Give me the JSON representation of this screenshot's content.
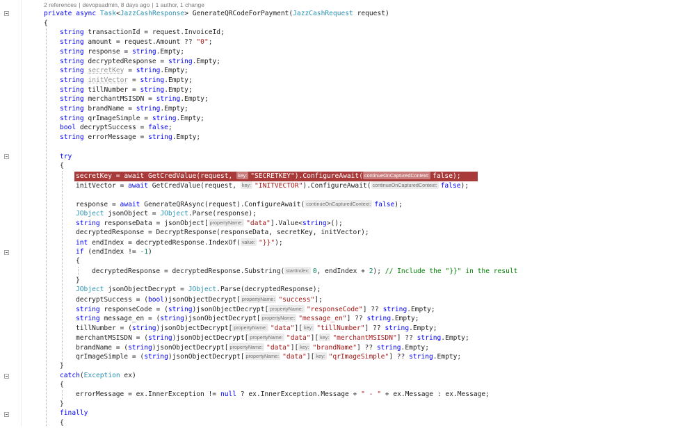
{
  "codelens": {
    "references": "2 references",
    "author_time": "devopsadmin, 8 days ago",
    "changes": "1 author, 1 change"
  },
  "colors": {
    "keyword": "#0000ff",
    "type": "#2b91af",
    "string": "#a31515",
    "number": "#098658",
    "comment": "#008000",
    "breakpoint_bg": "#a83a3a"
  },
  "code": [
    {
      "indent": 0,
      "tokens": [
        [
          "kw",
          "private"
        ],
        [
          "p",
          " "
        ],
        [
          "kw",
          "async"
        ],
        [
          "p",
          " "
        ],
        [
          "ty",
          "Task"
        ],
        [
          "p",
          "<"
        ],
        [
          "ty",
          "JazzCashResponse"
        ],
        [
          "p",
          "> GenerateQRCodeForPayment("
        ],
        [
          "ty",
          "JazzCashRequest"
        ],
        [
          "p",
          " request)"
        ]
      ]
    },
    {
      "indent": 0,
      "tokens": [
        [
          "p",
          "{"
        ]
      ]
    },
    {
      "indent": 1,
      "tokens": [
        [
          "kw",
          "string"
        ],
        [
          "p",
          " transactionId = request.InvoiceId;"
        ]
      ]
    },
    {
      "indent": 1,
      "tokens": [
        [
          "kw",
          "string"
        ],
        [
          "p",
          " amount = request.Amount ?? "
        ],
        [
          "str",
          "\"0\""
        ],
        [
          "p",
          ";"
        ]
      ]
    },
    {
      "indent": 1,
      "tokens": [
        [
          "kw",
          "string"
        ],
        [
          "p",
          " response = "
        ],
        [
          "kw",
          "string"
        ],
        [
          "p",
          ".Empty;"
        ]
      ]
    },
    {
      "indent": 1,
      "tokens": [
        [
          "kw",
          "string"
        ],
        [
          "p",
          " decryptedResponse = "
        ],
        [
          "kw",
          "string"
        ],
        [
          "p",
          ".Empty;"
        ]
      ]
    },
    {
      "indent": 1,
      "tokens": [
        [
          "kw",
          "string"
        ],
        [
          "p",
          " "
        ],
        [
          "un",
          "secretKey"
        ],
        [
          "p",
          " = "
        ],
        [
          "kw",
          "string"
        ],
        [
          "p",
          ".Empty;"
        ]
      ]
    },
    {
      "indent": 1,
      "tokens": [
        [
          "kw",
          "string"
        ],
        [
          "p",
          " "
        ],
        [
          "un",
          "initVector"
        ],
        [
          "p",
          " = "
        ],
        [
          "kw",
          "string"
        ],
        [
          "p",
          ".Empty;"
        ]
      ]
    },
    {
      "indent": 1,
      "tokens": [
        [
          "kw",
          "string"
        ],
        [
          "p",
          " tillNumber = "
        ],
        [
          "kw",
          "string"
        ],
        [
          "p",
          ".Empty;"
        ]
      ]
    },
    {
      "indent": 1,
      "tokens": [
        [
          "kw",
          "string"
        ],
        [
          "p",
          " merchantMSISDN = "
        ],
        [
          "kw",
          "string"
        ],
        [
          "p",
          ".Empty;"
        ]
      ]
    },
    {
      "indent": 1,
      "tokens": [
        [
          "kw",
          "string"
        ],
        [
          "p",
          " brandName = "
        ],
        [
          "kw",
          "string"
        ],
        [
          "p",
          ".Empty;"
        ]
      ]
    },
    {
      "indent": 1,
      "tokens": [
        [
          "kw",
          "string"
        ],
        [
          "p",
          " qrImageSimple = "
        ],
        [
          "kw",
          "string"
        ],
        [
          "p",
          ".Empty;"
        ]
      ]
    },
    {
      "indent": 1,
      "tokens": [
        [
          "kw",
          "bool"
        ],
        [
          "p",
          " decryptSuccess = "
        ],
        [
          "kw",
          "false"
        ],
        [
          "p",
          ";"
        ]
      ]
    },
    {
      "indent": 1,
      "tokens": [
        [
          "kw",
          "string"
        ],
        [
          "p",
          " errorMessage = "
        ],
        [
          "kw",
          "string"
        ],
        [
          "p",
          ".Empty;"
        ]
      ]
    },
    {
      "indent": 0,
      "tokens": []
    },
    {
      "indent": 1,
      "tokens": [
        [
          "kw",
          "try"
        ]
      ]
    },
    {
      "indent": 1,
      "tokens": [
        [
          "p",
          "{"
        ]
      ]
    },
    {
      "indent": 2,
      "bp": true,
      "tokens": [
        [
          "p",
          "secretKey = "
        ],
        [
          "kw",
          "await"
        ],
        [
          "p",
          " GetCredValue(request, "
        ],
        [
          "hint",
          "key:"
        ],
        [
          "str",
          "\"SECRETKEY\""
        ],
        [
          "p",
          ").ConfigureAwait("
        ],
        [
          "hint",
          "continueOnCapturedContext:"
        ],
        [
          "kw",
          "false"
        ],
        [
          "p",
          ");"
        ]
      ]
    },
    {
      "indent": 2,
      "tokens": [
        [
          "p",
          "initVector = "
        ],
        [
          "kw",
          "await"
        ],
        [
          "p",
          " GetCredValue(request, "
        ],
        [
          "hint",
          "key:"
        ],
        [
          "str",
          "\"INITVECTOR\""
        ],
        [
          "p",
          ").ConfigureAwait("
        ],
        [
          "hint",
          "continueOnCapturedContext:"
        ],
        [
          "kw",
          "false"
        ],
        [
          "p",
          ");"
        ]
      ]
    },
    {
      "indent": 0,
      "tokens": []
    },
    {
      "indent": 2,
      "tokens": [
        [
          "p",
          "response = "
        ],
        [
          "kw",
          "await"
        ],
        [
          "p",
          " GenerateQRAsync(request).ConfigureAwait("
        ],
        [
          "hint",
          "continueOnCapturedContext:"
        ],
        [
          "kw",
          "false"
        ],
        [
          "p",
          ");"
        ]
      ]
    },
    {
      "indent": 2,
      "tokens": [
        [
          "ty",
          "JObject"
        ],
        [
          "p",
          " jsonObject = "
        ],
        [
          "ty",
          "JObject"
        ],
        [
          "p",
          ".Parse(response);"
        ]
      ]
    },
    {
      "indent": 2,
      "tokens": [
        [
          "kw",
          "string"
        ],
        [
          "p",
          " responseData = jsonObject["
        ],
        [
          "hint",
          "propertyName:"
        ],
        [
          "str",
          "\"data\""
        ],
        [
          "p",
          "].Value<"
        ],
        [
          "kw",
          "string"
        ],
        [
          "p",
          ">();"
        ]
      ]
    },
    {
      "indent": 2,
      "tokens": [
        [
          "p",
          "decryptedResponse = DecryptResponse(responseData, secretKey, initVector);"
        ]
      ]
    },
    {
      "indent": 2,
      "tokens": [
        [
          "kw",
          "int"
        ],
        [
          "p",
          " endIndex = decryptedResponse.IndexOf("
        ],
        [
          "hint",
          "value:"
        ],
        [
          "str",
          "\"}}\""
        ],
        [
          "p",
          ");"
        ]
      ]
    },
    {
      "indent": 2,
      "tokens": [
        [
          "kw",
          "if"
        ],
        [
          "p",
          " (endIndex != "
        ],
        [
          "num",
          "-1"
        ],
        [
          "p",
          ")"
        ]
      ]
    },
    {
      "indent": 2,
      "tokens": [
        [
          "p",
          "{"
        ]
      ]
    },
    {
      "indent": 3,
      "tokens": [
        [
          "p",
          "decryptedResponse = decryptedResponse.Substring("
        ],
        [
          "hint",
          "startIndex:"
        ],
        [
          "num",
          "0"
        ],
        [
          "p",
          ", endIndex + "
        ],
        [
          "num",
          "2"
        ],
        [
          "p",
          "); "
        ],
        [
          "com",
          "// Include the \"}}\" in the result"
        ]
      ]
    },
    {
      "indent": 2,
      "tokens": [
        [
          "p",
          "}"
        ]
      ]
    },
    {
      "indent": 2,
      "tokens": [
        [
          "ty",
          "JObject"
        ],
        [
          "p",
          " jsonObjectDecrypt = "
        ],
        [
          "ty",
          "JObject"
        ],
        [
          "p",
          ".Parse(decryptedResponse);"
        ]
      ]
    },
    {
      "indent": 2,
      "tokens": [
        [
          "p",
          "decryptSuccess = ("
        ],
        [
          "kw",
          "bool"
        ],
        [
          "p",
          ")jsonObjectDecrypt["
        ],
        [
          "hint",
          "propertyName:"
        ],
        [
          "str",
          "\"success\""
        ],
        [
          "p",
          "];"
        ]
      ]
    },
    {
      "indent": 2,
      "tokens": [
        [
          "kw",
          "string"
        ],
        [
          "p",
          " responseCode = ("
        ],
        [
          "kw",
          "string"
        ],
        [
          "p",
          ")jsonObjectDecrypt["
        ],
        [
          "hint",
          "propertyName:"
        ],
        [
          "str",
          "\"responseCode\""
        ],
        [
          "p",
          "] ?? "
        ],
        [
          "kw",
          "string"
        ],
        [
          "p",
          ".Empty;"
        ]
      ]
    },
    {
      "indent": 2,
      "tokens": [
        [
          "kw",
          "string"
        ],
        [
          "p",
          " message_en = ("
        ],
        [
          "kw",
          "string"
        ],
        [
          "p",
          ")jsonObjectDecrypt["
        ],
        [
          "hint",
          "propertyName:"
        ],
        [
          "str",
          "\"message_en\""
        ],
        [
          "p",
          "] ?? "
        ],
        [
          "kw",
          "string"
        ],
        [
          "p",
          ".Empty;"
        ]
      ]
    },
    {
      "indent": 2,
      "tokens": [
        [
          "p",
          "tillNumber = ("
        ],
        [
          "kw",
          "string"
        ],
        [
          "p",
          ")jsonObjectDecrypt["
        ],
        [
          "hint",
          "propertyName:"
        ],
        [
          "str",
          "\"data\""
        ],
        [
          "p",
          "]["
        ],
        [
          "hint",
          "key:"
        ],
        [
          "str",
          "\"tillNumber\""
        ],
        [
          "p",
          "] ?? "
        ],
        [
          "kw",
          "string"
        ],
        [
          "p",
          ".Empty;"
        ]
      ]
    },
    {
      "indent": 2,
      "tokens": [
        [
          "p",
          "merchantMSISDN = ("
        ],
        [
          "kw",
          "string"
        ],
        [
          "p",
          ")jsonObjectDecrypt["
        ],
        [
          "hint",
          "propertyName:"
        ],
        [
          "str",
          "\"data\""
        ],
        [
          "p",
          "]["
        ],
        [
          "hint",
          "key:"
        ],
        [
          "str",
          "\"merchantMSISDN\""
        ],
        [
          "p",
          "] ?? "
        ],
        [
          "kw",
          "string"
        ],
        [
          "p",
          ".Empty;"
        ]
      ]
    },
    {
      "indent": 2,
      "tokens": [
        [
          "p",
          "brandName = ("
        ],
        [
          "kw",
          "string"
        ],
        [
          "p",
          ")jsonObjectDecrypt["
        ],
        [
          "hint",
          "propertyName:"
        ],
        [
          "str",
          "\"data\""
        ],
        [
          "p",
          "]["
        ],
        [
          "hint",
          "key:"
        ],
        [
          "str",
          "\"brandName\""
        ],
        [
          "p",
          "] ?? "
        ],
        [
          "kw",
          "string"
        ],
        [
          "p",
          ".Empty;"
        ]
      ]
    },
    {
      "indent": 2,
      "tokens": [
        [
          "p",
          "qrImageSimple = ("
        ],
        [
          "kw",
          "string"
        ],
        [
          "p",
          ")jsonObjectDecrypt["
        ],
        [
          "hint",
          "propertyName:"
        ],
        [
          "str",
          "\"data\""
        ],
        [
          "p",
          "]["
        ],
        [
          "hint",
          "key:"
        ],
        [
          "str",
          "\"qrImageSimple\""
        ],
        [
          "p",
          "] ?? "
        ],
        [
          "kw",
          "string"
        ],
        [
          "p",
          ".Empty;"
        ]
      ]
    },
    {
      "indent": 1,
      "tokens": [
        [
          "p",
          "}"
        ]
      ]
    },
    {
      "indent": 1,
      "tokens": [
        [
          "kw",
          "catch"
        ],
        [
          "p",
          "("
        ],
        [
          "ty",
          "Exception"
        ],
        [
          "p",
          " ex)"
        ]
      ]
    },
    {
      "indent": 1,
      "tokens": [
        [
          "p",
          "{"
        ]
      ]
    },
    {
      "indent": 2,
      "tokens": [
        [
          "p",
          "errorMessage = ex.InnerException != "
        ],
        [
          "kw",
          "null"
        ],
        [
          "p",
          " ? ex.InnerException.Message + "
        ],
        [
          "str",
          "\" - \""
        ],
        [
          "p",
          " + ex.Message : ex.Message;"
        ]
      ]
    },
    {
      "indent": 1,
      "tokens": [
        [
          "p",
          "}"
        ]
      ]
    },
    {
      "indent": 1,
      "tokens": [
        [
          "kw",
          "finally"
        ]
      ]
    },
    {
      "indent": 1,
      "tokens": [
        [
          "p",
          "{"
        ]
      ]
    }
  ]
}
